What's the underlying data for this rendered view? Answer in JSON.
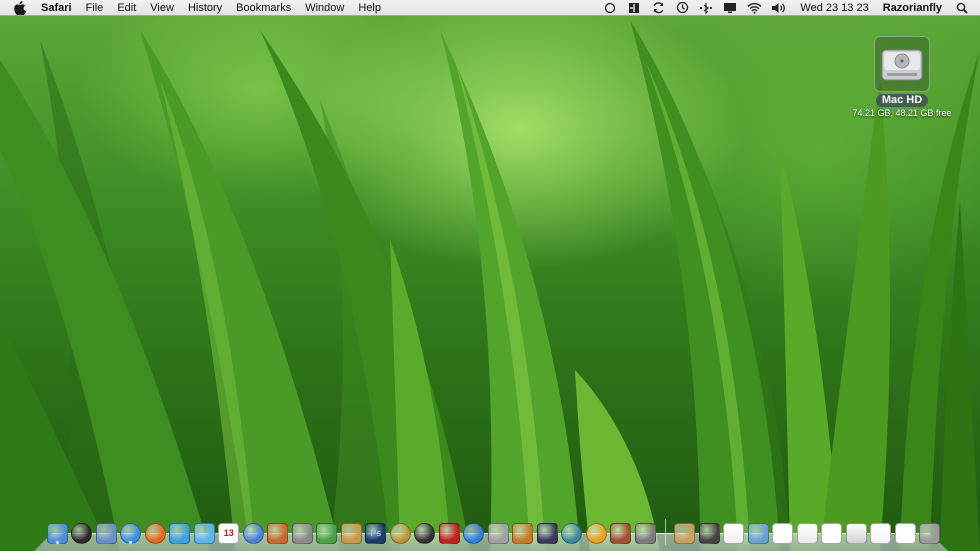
{
  "menubar": {
    "apple_icon": "apple-icon",
    "app_name": "Safari",
    "menus": [
      "File",
      "Edit",
      "View",
      "History",
      "Bookmarks",
      "Window",
      "Help"
    ],
    "status_icons": [
      "circle-icon",
      "split-box-icon",
      "sync-icon",
      "time-machine-icon",
      "bluetooth-dots-icon",
      "display-icon",
      "wifi-icon",
      "volume-icon"
    ],
    "clock": "Wed 23 13 23",
    "user": "Razorianfly",
    "spotlight_icon": "spotlight-search-icon"
  },
  "desktop": {
    "drive": {
      "name": "Mac HD",
      "info": "74.21 GB, 48.21 GB free",
      "icon": "hard-drive-icon"
    }
  },
  "dock": {
    "apps": [
      {
        "name": "Finder",
        "icon": "finder-icon",
        "color": "#4a90d9",
        "running": true
      },
      {
        "name": "Dashboard",
        "icon": "dashboard-icon",
        "color": "#2a2a2a",
        "running": false
      },
      {
        "name": "Preview",
        "icon": "preview-icon",
        "color": "#6a8fc8",
        "running": false
      },
      {
        "name": "Safari",
        "icon": "safari-icon",
        "color": "#3c8fe0",
        "running": true
      },
      {
        "name": "Firefox",
        "icon": "firefox-icon",
        "color": "#e66a1a",
        "running": false
      },
      {
        "name": "Address Book",
        "icon": "people-icon",
        "color": "#3aa0e0",
        "running": false
      },
      {
        "name": "iChat",
        "icon": "chat-icon",
        "color": "#5bb4f0",
        "running": false
      },
      {
        "name": "iCal",
        "icon": "calendar-icon",
        "color": "#ffffff",
        "label": "13",
        "running": false
      },
      {
        "name": "iTunes",
        "icon": "itunes-icon",
        "color": "#4c7fd6",
        "running": false
      },
      {
        "name": "Keynote",
        "icon": "keynote-icon",
        "color": "#c86a30",
        "running": false
      },
      {
        "name": "Pen Tool",
        "icon": "pen-icon",
        "color": "#8a8a8a",
        "running": false
      },
      {
        "name": "Numbers",
        "icon": "chart-icon",
        "color": "#4aa04a",
        "running": false
      },
      {
        "name": "Photo Booth",
        "icon": "photos-icon",
        "color": "#c89a4a",
        "running": false
      },
      {
        "name": "Photoshop",
        "icon": "photoshop-icon",
        "color": "#1a3a6a",
        "label": "Ps",
        "running": false
      },
      {
        "name": "Aperture",
        "icon": "aperture-icon",
        "color": "#b8963a",
        "running": false
      },
      {
        "name": "DVD Player",
        "icon": "dvd-icon",
        "color": "#333333",
        "running": false
      },
      {
        "name": "Chess",
        "icon": "chess-icon",
        "color": "#c02020",
        "running": false
      },
      {
        "name": "Mail",
        "icon": "mail-icon",
        "color": "#2f7fd6",
        "running": false
      },
      {
        "name": "Utility",
        "icon": "utility-icon",
        "color": "#a0a0a0",
        "running": false
      },
      {
        "name": "GarageBand",
        "icon": "guitar-icon",
        "color": "#c87a2a",
        "running": false
      },
      {
        "name": "Mission Control",
        "icon": "spaces-icon",
        "color": "#3a3a5a",
        "running": false
      },
      {
        "name": "Time Machine",
        "icon": "time-machine-icon",
        "color": "#3a8a9a",
        "running": false
      },
      {
        "name": "Radiation",
        "icon": "radiation-icon",
        "color": "#e8a020",
        "running": false
      },
      {
        "name": "Text Edit",
        "icon": "notes-icon",
        "color": "#a05030",
        "running": false
      },
      {
        "name": "Preferences",
        "icon": "gear-icon",
        "color": "#7a7a7a",
        "running": false
      }
    ],
    "docs": [
      {
        "name": "Clipboard",
        "icon": "clipboard-icon",
        "color": "#c8a060"
      },
      {
        "name": "Drive",
        "icon": "drive-icon",
        "color": "#444444"
      },
      {
        "name": "Document",
        "icon": "document-icon",
        "color": "#f0f0f0"
      },
      {
        "name": "Installer",
        "icon": "installer-icon",
        "color": "#6aa0d0"
      },
      {
        "name": "Window",
        "icon": "window-icon",
        "color": "#ffffff"
      },
      {
        "name": "Page",
        "icon": "page-icon",
        "color": "#e8e8e8"
      },
      {
        "name": "Screenshot 1",
        "icon": "screenshot-icon",
        "color": "#ffffff"
      },
      {
        "name": "Screenshot 2",
        "icon": "screenshot-icon",
        "color": "#d0d0d0"
      },
      {
        "name": "Text File",
        "icon": "text-file-icon",
        "color": "#f5f5f5"
      },
      {
        "name": "Screenshot 3",
        "icon": "screenshot-icon",
        "color": "#ffffff"
      },
      {
        "name": "Trash",
        "icon": "trash-icon",
        "color": "#9a9a9a"
      }
    ]
  }
}
